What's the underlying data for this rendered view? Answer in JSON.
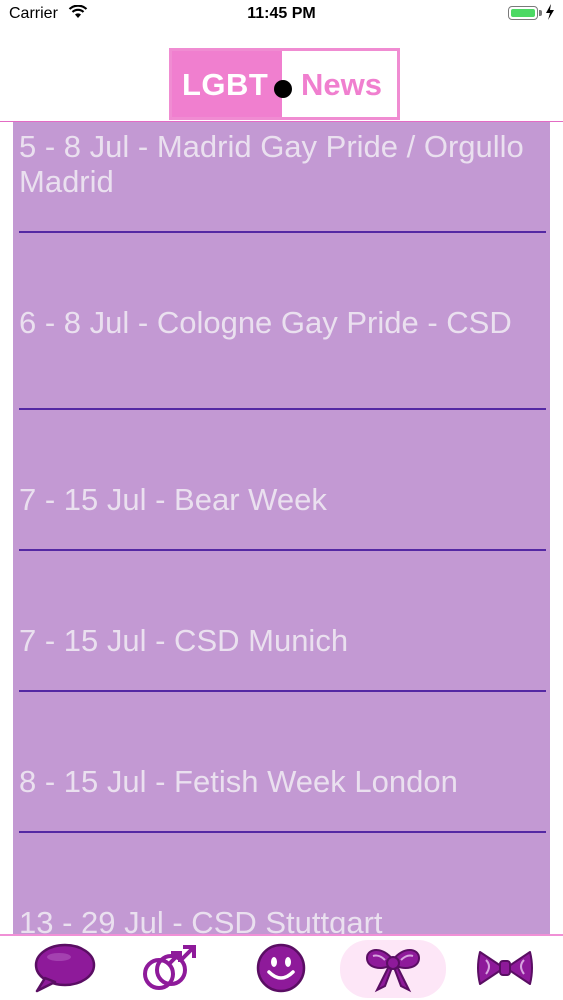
{
  "status_bar": {
    "carrier": "Carrier",
    "time": "11:45 PM"
  },
  "logo": {
    "left": "LGBT",
    "right": "News"
  },
  "events": [
    {
      "label": "5 - 8 Jul - Madrid Gay Pride / Orgullo Madrid"
    },
    {
      "label": "6 - 8 Jul - Cologne Gay Pride - CSD"
    },
    {
      "label": "7 - 15 Jul - Bear Week"
    },
    {
      "label": "7 - 15 Jul - CSD Munich"
    },
    {
      "label": "8 - 15 Jul - Fetish Week London"
    },
    {
      "label": "13 - 29 Jul - CSD Stuttgart"
    }
  ],
  "tabs": [
    {
      "icon": "speech-bubble-icon"
    },
    {
      "icon": "gender-symbols-icon"
    },
    {
      "icon": "smiley-icon"
    },
    {
      "icon": "bow-icon",
      "active": true
    },
    {
      "icon": "bowtie-icon"
    }
  ],
  "colors": {
    "accent": "#f07fcf",
    "list_bg": "#c399d3",
    "icon": "#8e1a9a",
    "separator": "#5428a3"
  }
}
